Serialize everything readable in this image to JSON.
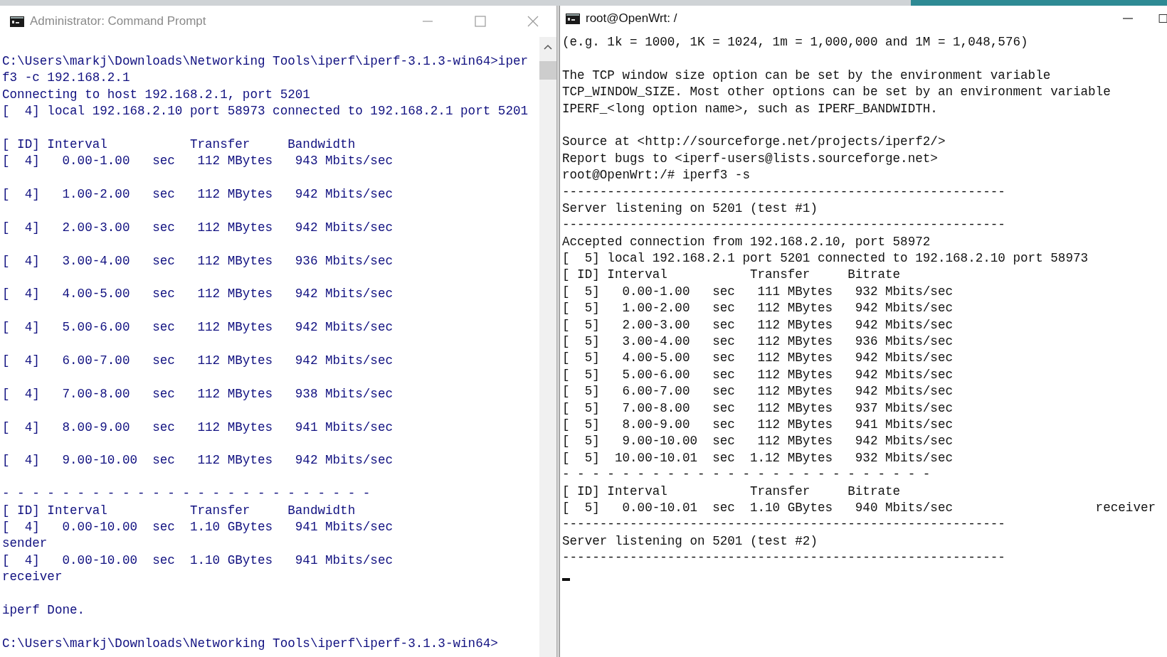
{
  "windows": [
    {
      "kind": "cmd",
      "title": "Administrator: Command Prompt",
      "active": false,
      "blocks": [
        [
          "C:\\Users\\markj\\Downloads\\Networking Tools\\iperf\\iperf-3.1.3-win64>iper",
          "f3 -c 192.168.2.1",
          "Connecting to host 192.168.2.1, port 5201",
          "[  4] local 192.168.2.10 port 58973 connected to 192.168.2.1 port 5201"
        ],
        [
          "[ ID] Interval           Transfer     Bandwidth",
          "[  4]   0.00-1.00   sec   112 MBytes   943 Mbits/sec"
        ],
        [
          "[  4]   1.00-2.00   sec   112 MBytes   942 Mbits/sec"
        ],
        [
          "[  4]   2.00-3.00   sec   112 MBytes   942 Mbits/sec"
        ],
        [
          "[  4]   3.00-4.00   sec   112 MBytes   936 Mbits/sec"
        ],
        [
          "[  4]   4.00-5.00   sec   112 MBytes   942 Mbits/sec"
        ],
        [
          "[  4]   5.00-6.00   sec   112 MBytes   942 Mbits/sec"
        ],
        [
          "[  4]   6.00-7.00   sec   112 MBytes   942 Mbits/sec"
        ],
        [
          "[  4]   7.00-8.00   sec   112 MBytes   938 Mbits/sec"
        ],
        [
          "[  4]   8.00-9.00   sec   112 MBytes   941 Mbits/sec"
        ],
        [
          "[  4]   9.00-10.00  sec   112 MBytes   942 Mbits/sec"
        ],
        [
          "- - - - - - - - - - - - - - - - - - - - - - - - -",
          "[ ID] Interval           Transfer     Bandwidth",
          "[  4]   0.00-10.00  sec  1.10 GBytes   941 Mbits/sec",
          "sender",
          "[  4]   0.00-10.00  sec  1.10 GBytes   941 Mbits/sec",
          "receiver"
        ],
        [
          "iperf Done."
        ],
        [
          "C:\\Users\\markj\\Downloads\\Networking Tools\\iperf\\iperf-3.1.3-win64>"
        ]
      ]
    },
    {
      "kind": "shell",
      "title": "root@OpenWrt: /",
      "active": true,
      "blocks": [
        [
          "(e.g. 1k = 1000, 1K = 1024, 1m = 1,000,000 and 1M = 1,048,576)"
        ],
        [
          "The TCP window size option can be set by the environment variable",
          "TCP_WINDOW_SIZE. Most other options can be set by an environment variable",
          "IPERF_<long option name>, such as IPERF_BANDWIDTH."
        ],
        [
          "Source at <http://sourceforge.net/projects/iperf2/>",
          "Report bugs to <iperf-users@lists.sourceforge.net>",
          "root@OpenWrt:/# iperf3 -s",
          "-----------------------------------------------------------",
          "Server listening on 5201 (test #1)",
          "-----------------------------------------------------------",
          "Accepted connection from 192.168.2.10, port 58972",
          "[  5] local 192.168.2.1 port 5201 connected to 192.168.2.10 port 58973",
          "[ ID] Interval           Transfer     Bitrate",
          "[  5]   0.00-1.00   sec   111 MBytes   932 Mbits/sec",
          "[  5]   1.00-2.00   sec   112 MBytes   942 Mbits/sec",
          "[  5]   2.00-3.00   sec   112 MBytes   942 Mbits/sec",
          "[  5]   3.00-4.00   sec   112 MBytes   936 Mbits/sec",
          "[  5]   4.00-5.00   sec   112 MBytes   942 Mbits/sec",
          "[  5]   5.00-6.00   sec   112 MBytes   942 Mbits/sec",
          "[  5]   6.00-7.00   sec   112 MBytes   942 Mbits/sec",
          "[  5]   7.00-8.00   sec   112 MBytes   937 Mbits/sec",
          "[  5]   8.00-9.00   sec   112 MBytes   941 Mbits/sec",
          "[  5]   9.00-10.00  sec   112 MBytes   942 Mbits/sec",
          "[  5]  10.00-10.01  sec  1.12 MBytes   932 Mbits/sec",
          "- - - - - - - - - - - - - - - - - - - - - - - - -",
          "[ ID] Interval           Transfer     Bitrate",
          "[  5]   0.00-10.01  sec  1.10 GBytes   940 Mbits/sec                   receiver",
          "-----------------------------------------------------------",
          "Server listening on 5201 (test #2)",
          "-----------------------------------------------------------"
        ]
      ],
      "cursor": true
    }
  ]
}
